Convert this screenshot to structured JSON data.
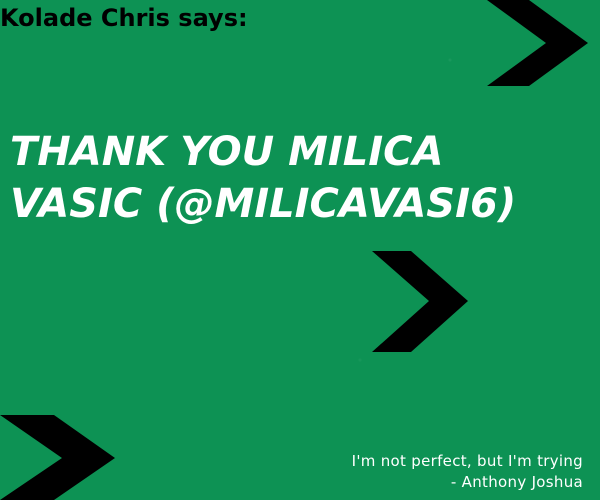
{
  "speaker": "Kolade Chris says:",
  "headline": {
    "line1": "THANK YOU MILICA",
    "line2": "VASIC (@MILICAVASI6)"
  },
  "quote": {
    "text": "I'm not perfect, but I'm trying",
    "attribution": "- Anthony Joshua"
  },
  "colors": {
    "background": "#0d9254",
    "arrow": "#000000",
    "headline": "#ffffff",
    "speaker": "#000000"
  }
}
